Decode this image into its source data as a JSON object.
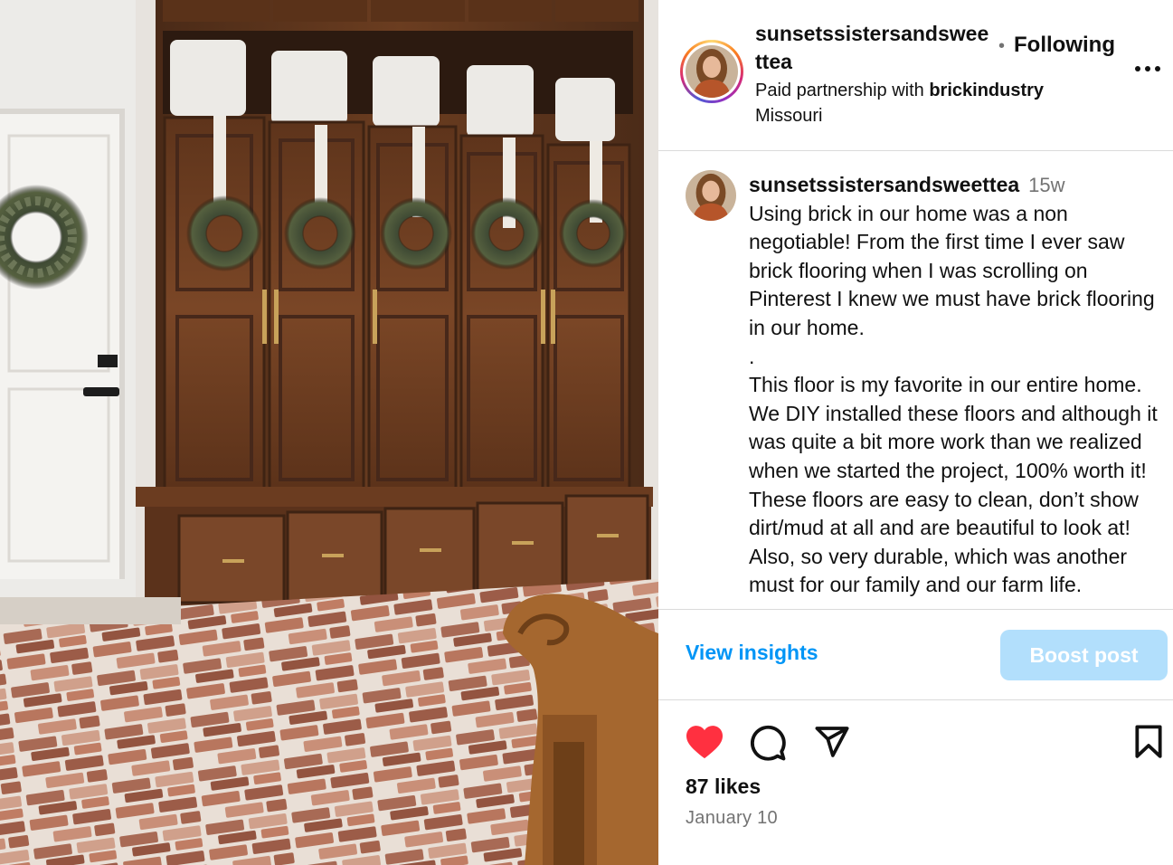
{
  "post": {
    "username_header": "sunsetssistersandsweettea",
    "follow_status": "Following",
    "separator": "•",
    "more_label": "...",
    "partnership_prefix": "Paid partnership with ",
    "partner": "brickindustry",
    "location": "Missouri"
  },
  "caption": {
    "username": "sunsetssistersandsweettea",
    "time_ago": "15w",
    "text": "Using brick in our home was a non negotiable! From the first time I ever saw brick flooring when I was scrolling on Pinterest I knew we must have brick flooring in our home.\n.\nThis floor is my favorite in our entire home. We DIY installed these floors and although it was quite a bit more work than we realized when we started the project, 100% worth it! These floors are easy to clean, don’t show dirt/mud at all and are beautiful to look at! Also, so very durable, which was another must for our family and our farm life."
  },
  "actions": {
    "view_insights": "View insights",
    "boost_post": "Boost post"
  },
  "engagement": {
    "likes": "87 likes",
    "date": "January 10"
  },
  "colors": {
    "link_blue": "#0095f6",
    "boost_disabled": "#b2dffc",
    "like_red": "#ff3040"
  },
  "icons": {
    "like": "heart-icon",
    "comment": "comment-icon",
    "share": "share-icon",
    "save": "bookmark-icon",
    "more": "more-options-icon"
  }
}
